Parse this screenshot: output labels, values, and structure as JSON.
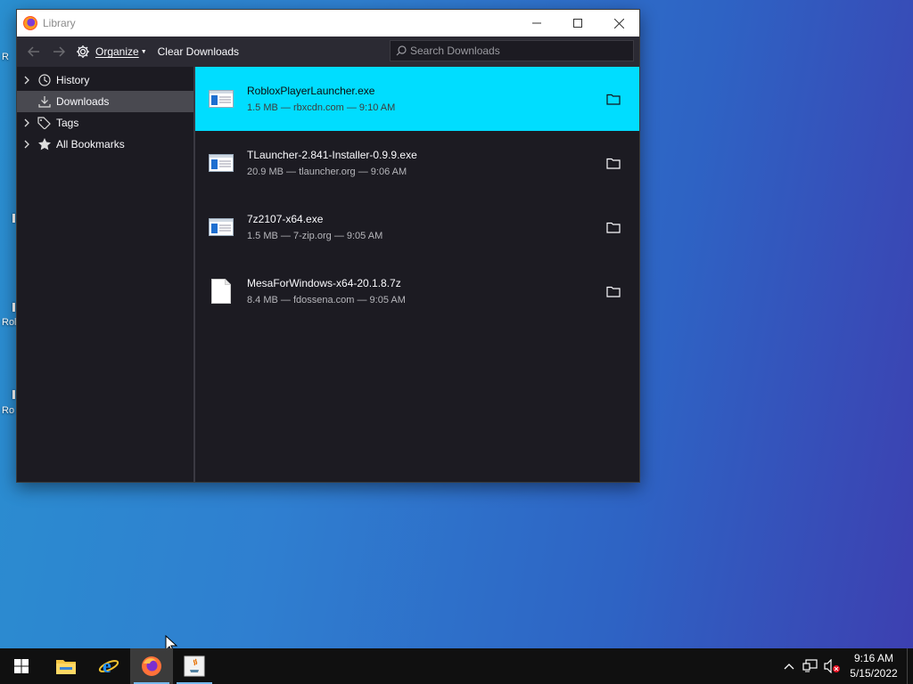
{
  "desktop": {
    "partial_labels": [
      "R",
      "Rol",
      "Ro"
    ]
  },
  "window": {
    "title": "Library",
    "controls": {
      "minimize": "minimize",
      "maximize": "maximize",
      "close": "close"
    }
  },
  "toolbar": {
    "organize_label": "Organize",
    "clear_label": "Clear Downloads",
    "search_placeholder": "Search Downloads"
  },
  "sidebar": {
    "items": [
      {
        "label": "History",
        "icon": "clock-icon",
        "expandable": true
      },
      {
        "label": "Downloads",
        "icon": "download-icon",
        "expandable": false,
        "selected": true
      },
      {
        "label": "Tags",
        "icon": "tag-icon",
        "expandable": true
      },
      {
        "label": "All Bookmarks",
        "icon": "star-icon",
        "expandable": true
      }
    ]
  },
  "downloads": [
    {
      "name": "RobloxPlayerLauncher.exe",
      "meta": "1.5 MB — rbxcdn.com — 9:10 AM",
      "icon": "exe-icon",
      "selected": true
    },
    {
      "name": "TLauncher-2.841-Installer-0.9.9.exe",
      "meta": "20.9 MB — tlauncher.org — 9:06 AM",
      "icon": "exe-icon"
    },
    {
      "name": "7z2107-x64.exe",
      "meta": "1.5 MB — 7-zip.org — 9:05 AM",
      "icon": "exe-icon"
    },
    {
      "name": "MesaForWindows-x64-20.1.8.7z",
      "meta": "8.4 MB — fdossena.com — 9:05 AM",
      "icon": "file-icon"
    }
  ],
  "taskbar": {
    "items": [
      "start",
      "file-explorer",
      "internet-explorer",
      "firefox",
      "java"
    ],
    "clock": {
      "time": "9:16 AM",
      "date": "5/15/2022"
    }
  },
  "colors": {
    "selected_row": "#00ddff",
    "window_bg": "#1c1b22",
    "toolbar_bg": "#2b2a33"
  }
}
